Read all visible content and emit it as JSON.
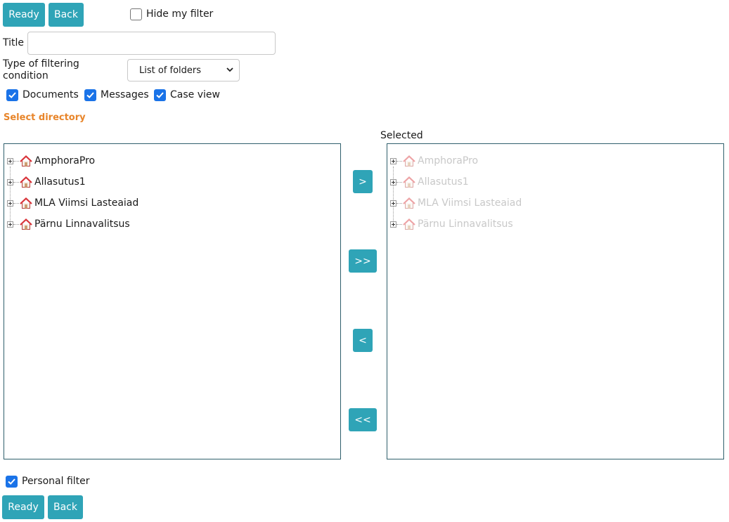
{
  "toolbar_top": {
    "ready_label": "Ready",
    "back_label": "Back"
  },
  "hide_filter": {
    "label": "Hide my filter",
    "checked": false
  },
  "title_field": {
    "label": "Title",
    "value": ""
  },
  "filter_type": {
    "label": "Type of filtering condition",
    "selected": "List of folders"
  },
  "content_types": [
    {
      "label": "Documents",
      "checked": true
    },
    {
      "label": "Messages",
      "checked": true
    },
    {
      "label": "Case view",
      "checked": true
    }
  ],
  "section": {
    "title": "Select directory"
  },
  "selected_panel": {
    "label": "Selected"
  },
  "left_tree": {
    "items": [
      {
        "label": "AmphoraPro"
      },
      {
        "label": "Allasutus1"
      },
      {
        "label": "MLA Viimsi Lasteaiad"
      },
      {
        "label": "Pärnu Linnavalitsus"
      }
    ]
  },
  "right_tree": {
    "items": [
      {
        "label": "AmphoraPro"
      },
      {
        "label": "Allasutus1"
      },
      {
        "label": "MLA Viimsi Lasteaiad"
      },
      {
        "label": "Pärnu Linnavalitsus"
      }
    ]
  },
  "move_buttons": {
    "add_one": ">",
    "add_all": ">>",
    "remove_one": "<",
    "remove_all": "<<"
  },
  "personal_filter": {
    "label": "Personal filter",
    "checked": true
  },
  "toolbar_bottom": {
    "ready_label": "Ready",
    "back_label": "Back"
  },
  "colors": {
    "button": "#2fa4b7",
    "checkbox": "#1a73e8",
    "section_title": "#e8852a",
    "tree_border": "#2f5f6c",
    "house_icon": "#d9343a"
  }
}
